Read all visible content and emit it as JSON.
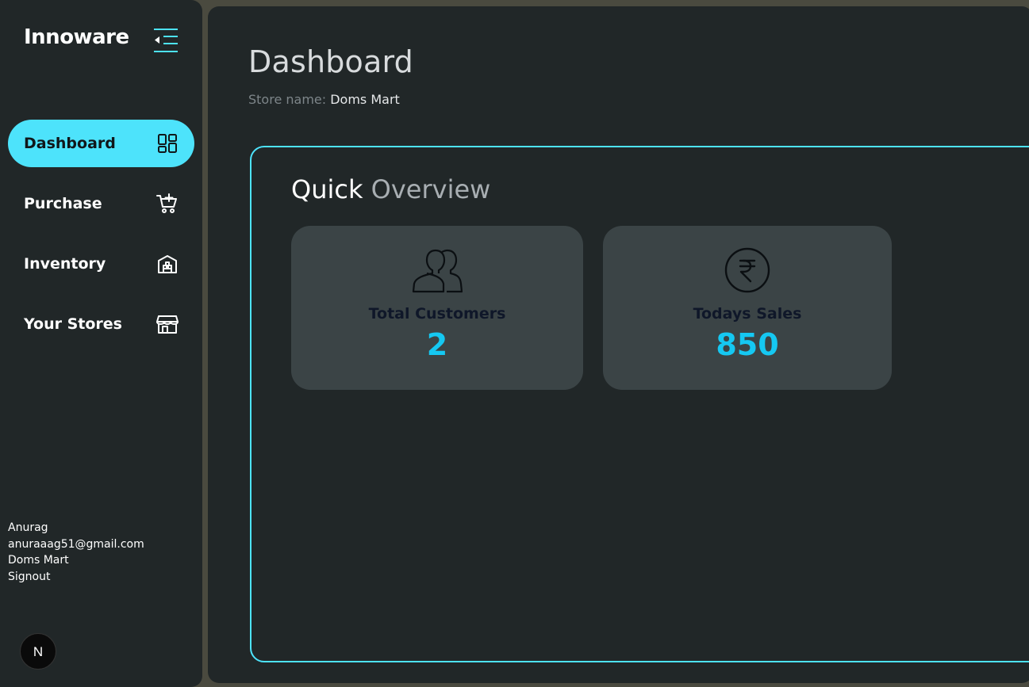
{
  "sidebar": {
    "brand": "Innoware",
    "collapse_icon": "collapse-menu-icon",
    "items": [
      {
        "label": "Dashboard",
        "icon": "dashboard-grid-icon",
        "active": true
      },
      {
        "label": "Purchase",
        "icon": "cart-plus-icon",
        "active": false
      },
      {
        "label": "Inventory",
        "icon": "warehouse-icon",
        "active": false
      },
      {
        "label": "Your Stores",
        "icon": "storefront-icon",
        "active": false
      }
    ],
    "user": {
      "name": "Anurag",
      "email": "anuraaag51@gmail.com",
      "store": "Doms Mart",
      "signout": "Signout"
    },
    "badge": "N"
  },
  "main": {
    "title": "Dashboard",
    "store_label": "Store name:",
    "store_value": "Doms Mart",
    "overview": {
      "title_part1": "Quick",
      "title_part2": "Overview",
      "cards": [
        {
          "label": "Total Customers",
          "value": "2",
          "icon": "users-icon"
        },
        {
          "label": "Todays Sales",
          "value": "850",
          "icon": "rupee-icon"
        }
      ]
    }
  },
  "colors": {
    "accent": "#4de3fb",
    "value_text": "#15c8f2",
    "panel": "#212728",
    "card": "#3b4446",
    "backdrop": "#4a4a3f"
  }
}
